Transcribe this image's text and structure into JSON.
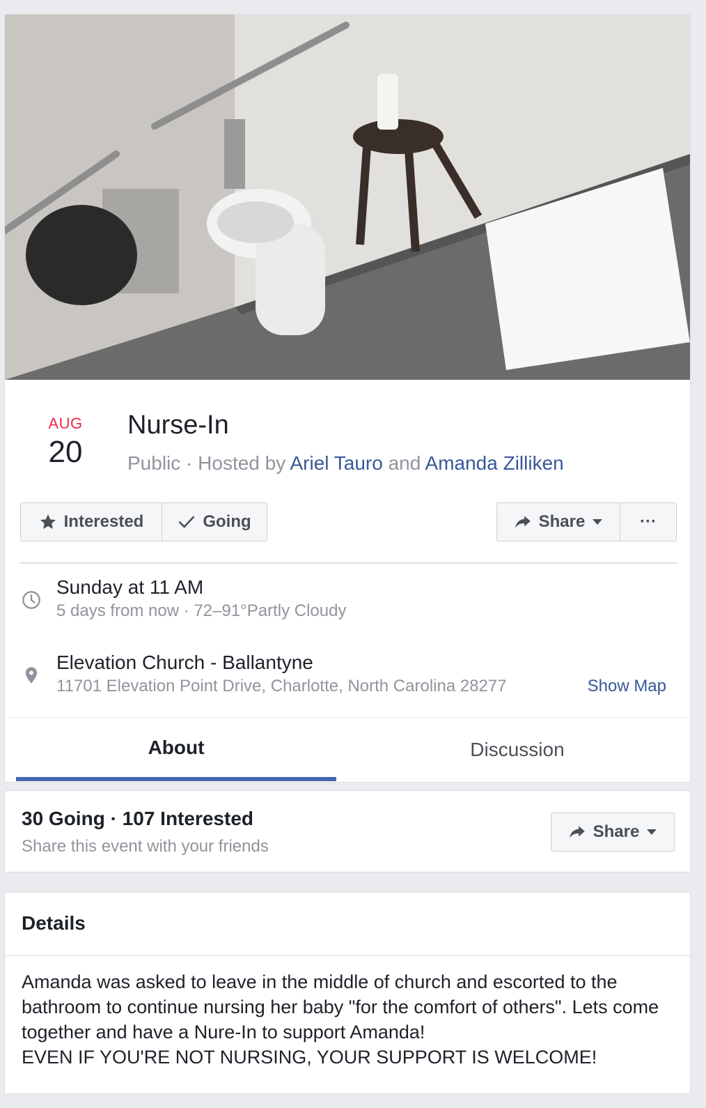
{
  "event": {
    "date_month": "AUG",
    "date_day": "20",
    "title": "Nurse-In",
    "privacy": "Public",
    "hosted_by_prefix": "Hosted by",
    "host_1": "Ariel Tauro",
    "host_conjunction": "and",
    "host_2": "Amanda Zilliken"
  },
  "actions": {
    "interested_label": "Interested",
    "going_label": "Going",
    "share_label": "Share",
    "more_label": "···"
  },
  "when": {
    "main": "Sunday at 11 AM",
    "sub": "5 days from now · 72–91°Partly Cloudy"
  },
  "where": {
    "main": "Elevation Church - Ballantyne",
    "sub": "11701 Elevation Point Drive, Charlotte, North Carolina 28277",
    "show_map": "Show Map"
  },
  "tabs": [
    {
      "label": "About",
      "active": true
    },
    {
      "label": "Discussion",
      "active": false
    }
  ],
  "stats": {
    "summary": "30 Going · 107 Interested",
    "sub": "Share this event with your friends",
    "share_label": "Share"
  },
  "details": {
    "heading": "Details",
    "paragraph_1": "Amanda was asked to leave in the middle of church and escorted to the bathroom to continue nursing her baby \"for the comfort of others\". Lets come together and have a Nure-In to support Amanda!",
    "paragraph_2": "EVEN IF YOU'RE NOT NURSING, YOUR SUPPORT IS WELCOME!"
  },
  "colors": {
    "link": "#385898",
    "accent_tab": "#4267b2",
    "month": "#f02849",
    "background": "#e9ebee"
  },
  "icons": [
    "star-icon",
    "check-icon",
    "share-arrow-icon",
    "caret-down-icon",
    "clock-icon",
    "map-pin-icon"
  ]
}
